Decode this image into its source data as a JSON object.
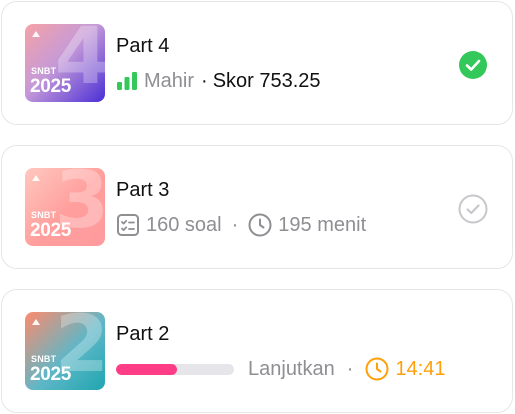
{
  "cards": [
    {
      "thumb": {
        "label": "SNBT",
        "year": "2025",
        "number": "4"
      },
      "title": "Part 4",
      "level": "Mahir",
      "separator": "·",
      "score_label": "Skor 753.25",
      "status_icon": "check-circle-filled-icon",
      "status_color": "#34c759"
    },
    {
      "thumb": {
        "label": "SNBT",
        "year": "2025",
        "number": "3"
      },
      "title": "Part 3",
      "questions": "160 soal",
      "separator": "·",
      "duration": "195 menit",
      "status_icon": "check-circle-outline-icon",
      "status_color": "#c7c7cc"
    },
    {
      "thumb": {
        "label": "SNBT",
        "year": "2025",
        "number": "2"
      },
      "title": "Part 2",
      "progress": 0.52,
      "progress_color": "#ff3d86",
      "action": "Lanjutkan",
      "separator": "·",
      "timer": "14:41",
      "timer_color": "#ff9f0a"
    }
  ]
}
